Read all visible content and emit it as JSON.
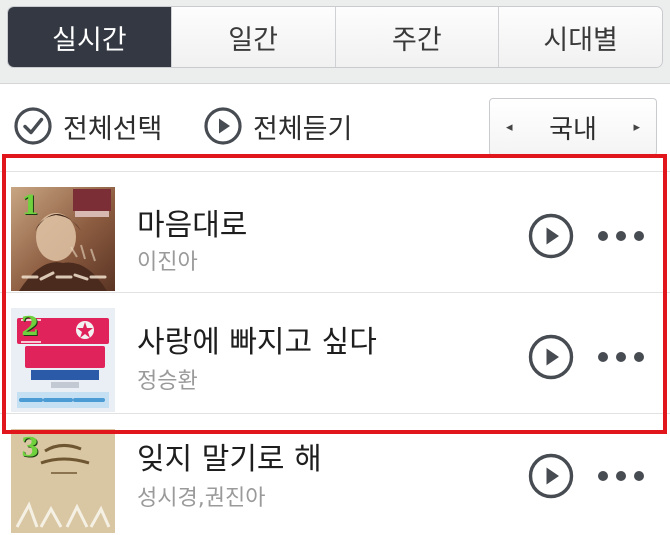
{
  "tabs": [
    {
      "label": "실시간",
      "active": true
    },
    {
      "label": "일간",
      "active": false
    },
    {
      "label": "주간",
      "active": false
    },
    {
      "label": "시대별",
      "active": false
    }
  ],
  "toolbar": {
    "select_all_label": "전체선택",
    "play_all_label": "전체듣기",
    "region": {
      "label": "국내",
      "prev_arrow": "◂",
      "next_arrow": "▸"
    }
  },
  "songs": [
    {
      "rank": "1",
      "title": "마음대로",
      "artist": "이진아",
      "album_art": "sepia-portrait-art"
    },
    {
      "rank": "2",
      "title": "사랑에 빠지고 싶다",
      "artist": "정승환",
      "album_art": "kpop-star-art"
    },
    {
      "rank": "3",
      "title": "잊지 말기로 해",
      "artist": "성시경,권진아",
      "album_art": "winter-wonderland-art"
    }
  ],
  "colors": {
    "active_tab": "#333842",
    "rank_number": "#6fd13d",
    "icon_dark": "#474b52",
    "highlight_box": "#e1161d"
  }
}
